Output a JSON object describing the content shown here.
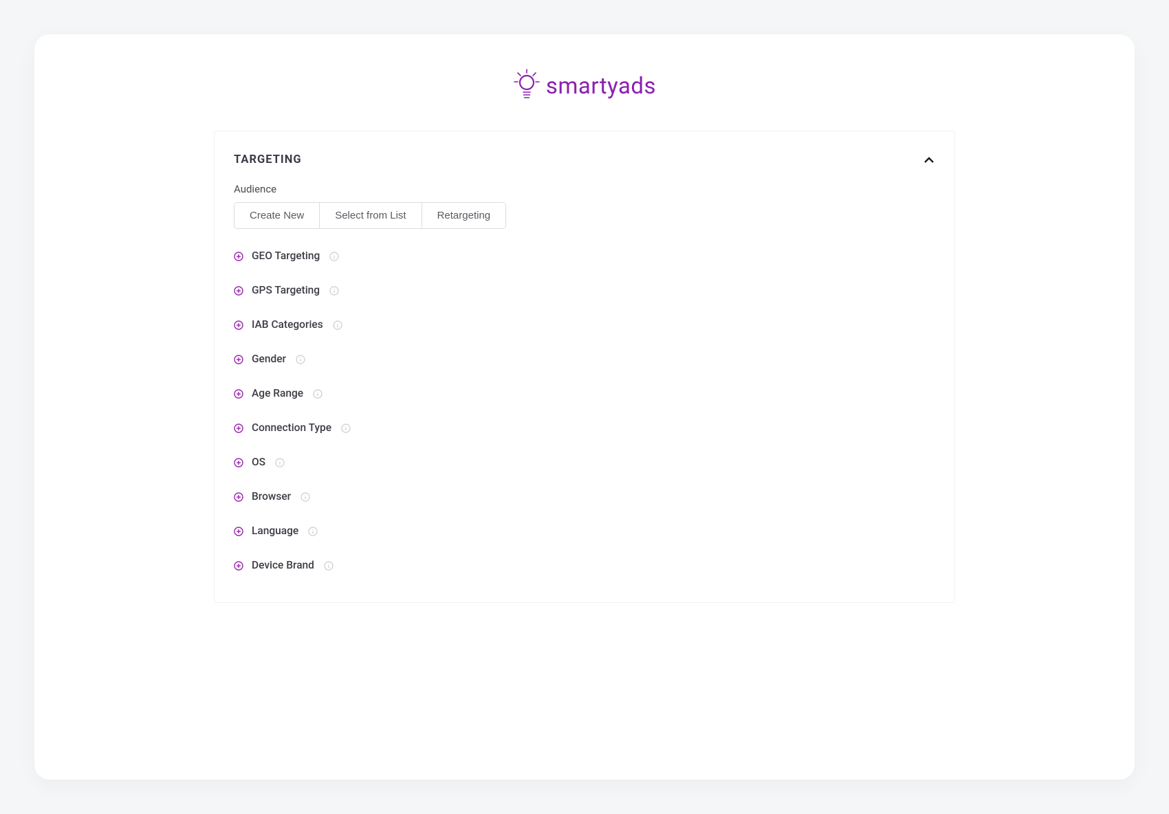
{
  "brand": {
    "name": "smartyads",
    "color": "#8b1fb0"
  },
  "panel": {
    "title": "TARGETING",
    "audience_label": "Audience",
    "buttons": {
      "create_new": "Create New",
      "select_from_list": "Select from List",
      "retargeting": "Retargeting"
    },
    "options": [
      {
        "label": "GEO Targeting"
      },
      {
        "label": "GPS Targeting"
      },
      {
        "label": "IAB Categories"
      },
      {
        "label": "Gender"
      },
      {
        "label": "Age Range"
      },
      {
        "label": "Connection Type"
      },
      {
        "label": "OS"
      },
      {
        "label": "Browser"
      },
      {
        "label": "Language"
      },
      {
        "label": "Device Brand"
      }
    ]
  }
}
